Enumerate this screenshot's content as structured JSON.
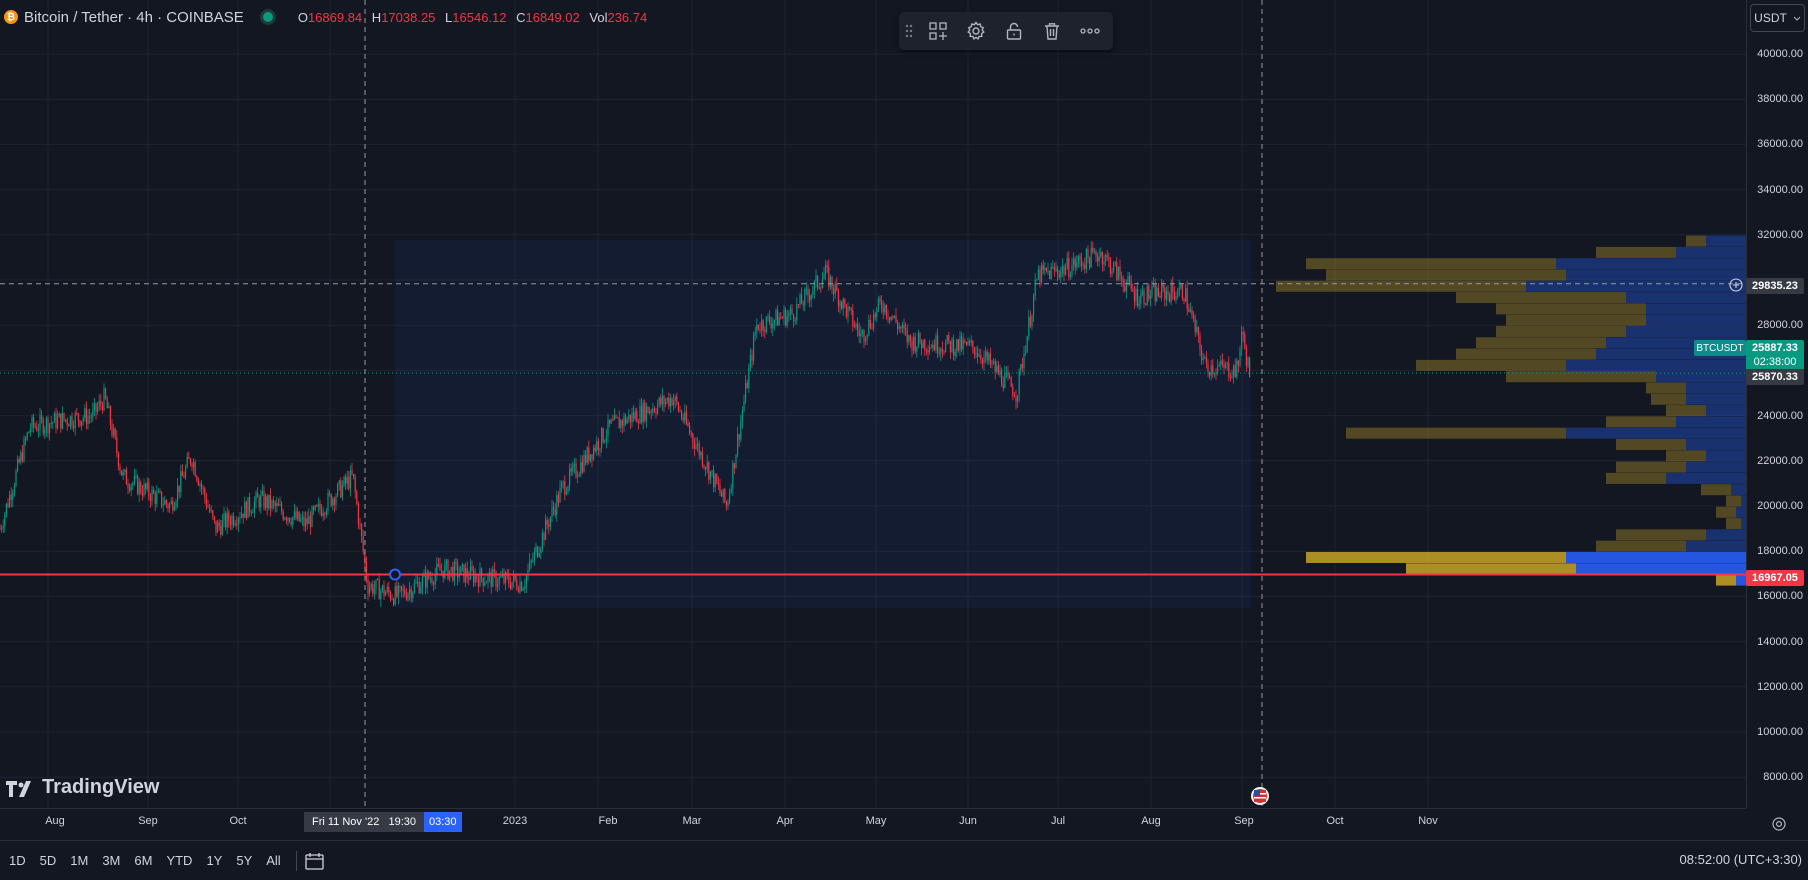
{
  "legend": {
    "symbol": "Bitcoin / Tether · 4h · COINBASE",
    "coin_icon": "bitcoin-icon",
    "ohlc": {
      "o_label": "O",
      "o": "16869.84",
      "h_label": "H",
      "h": "17038.25",
      "l_label": "L",
      "l": "16546.12",
      "c_label": "C",
      "c": "16849.02",
      "vol_label": "Vol",
      "vol": "236.74"
    }
  },
  "toolbar": {
    "icons": [
      "drag-handle-icon",
      "add-object-icon",
      "settings-icon",
      "unlock-icon",
      "trash-icon",
      "more-icon"
    ]
  },
  "currency": {
    "label": "USDT"
  },
  "y_axis": {
    "ticks": [
      "40000.00",
      "38000.00",
      "36000.00",
      "34000.00",
      "32000.00",
      "28000.00",
      "24000.00",
      "22000.00",
      "20000.00",
      "18000.00",
      "16000.00",
      "14000.00",
      "12000.00",
      "10000.00",
      "8000.00"
    ],
    "crosshair_price": "29835.23",
    "last_price": "25887.33",
    "countdown": "02:38:00",
    "prev_price": "25870.33",
    "line_price": "16967.05",
    "symbol_tag": "BTCUSDT"
  },
  "x_axis": {
    "ticks": [
      "Aug",
      "Sep",
      "Oct",
      "2023",
      "Feb",
      "Mar",
      "Apr",
      "May",
      "Jun",
      "Jul",
      "Aug",
      "Sep",
      "Oct",
      "Nov"
    ],
    "crosshair_date": "Fri 11 Nov '22",
    "crosshair_time": "19:30",
    "crosshair_time2": "03:30"
  },
  "watermark": "TradingView",
  "bottom": {
    "ranges": [
      "1D",
      "5D",
      "1M",
      "3M",
      "6M",
      "YTD",
      "1Y",
      "5Y",
      "All"
    ],
    "time": "08:52:00 (UTC+3:30)"
  },
  "colors": {
    "bg": "#131722",
    "up": "#089981",
    "down": "#f23645",
    "line": "#f23645",
    "vp_up": "#2962ff",
    "vp_down": "#c9a227",
    "last": "#089981",
    "accent": "#2962ff"
  },
  "chart_data": {
    "type": "candlestick",
    "interval": "4h",
    "y_range": [
      7000,
      42000
    ],
    "horizontal_line": 16967.05,
    "crosshair_price": 29835.23,
    "path_keypoints": [
      [
        "2022-07-10",
        19000
      ],
      [
        "2022-07-20",
        23500
      ],
      [
        "2022-07-30",
        23800
      ],
      [
        "2022-08-10",
        24000
      ],
      [
        "2022-08-14",
        24800
      ],
      [
        "2022-08-20",
        21300
      ],
      [
        "2022-09-05",
        20000
      ],
      [
        "2022-09-12",
        22200
      ],
      [
        "2022-09-20",
        19000
      ],
      [
        "2022-10-05",
        20300
      ],
      [
        "2022-10-20",
        19200
      ],
      [
        "2022-11-05",
        21300
      ],
      [
        "2022-11-10",
        16500
      ],
      [
        "2022-11-20",
        16000
      ],
      [
        "2022-12-05",
        17200
      ],
      [
        "2022-12-20",
        16800
      ],
      [
        "2023-01-01",
        16600
      ],
      [
        "2023-01-14",
        20800
      ],
      [
        "2023-01-30",
        23500
      ],
      [
        "2023-02-20",
        24800
      ],
      [
        "2023-03-10",
        20000
      ],
      [
        "2023-03-20",
        28000
      ],
      [
        "2023-04-01",
        28500
      ],
      [
        "2023-04-12",
        30300
      ],
      [
        "2023-04-24",
        27500
      ],
      [
        "2023-05-01",
        29000
      ],
      [
        "2023-05-10",
        27300
      ],
      [
        "2023-06-01",
        27000
      ],
      [
        "2023-06-15",
        25000
      ],
      [
        "2023-06-22",
        30200
      ],
      [
        "2023-07-01",
        30500
      ],
      [
        "2023-07-13",
        31200
      ],
      [
        "2023-07-25",
        29300
      ],
      [
        "2023-08-10",
        29500
      ],
      [
        "2023-08-17",
        26200
      ],
      [
        "2023-08-28",
        26000
      ],
      [
        "2023-08-29",
        27800
      ],
      [
        "2023-09-01",
        25800
      ]
    ],
    "volume_profile": [
      {
        "price": 31700,
        "up": 20,
        "down": 40
      },
      {
        "price": 31200,
        "up": 80,
        "down": 70
      },
      {
        "price": 30700,
        "up": 250,
        "down": 190
      },
      {
        "price": 30200,
        "up": 240,
        "down": 180
      },
      {
        "price": 29700,
        "up": 250,
        "down": 220
      },
      {
        "price": 29200,
        "up": 170,
        "down": 120
      },
      {
        "price": 28700,
        "up": 150,
        "down": 100
      },
      {
        "price": 28200,
        "up": 140,
        "down": 100
      },
      {
        "price": 27700,
        "up": 130,
        "down": 120
      },
      {
        "price": 27200,
        "up": 130,
        "down": 140
      },
      {
        "price": 26700,
        "up": 140,
        "down": 150
      },
      {
        "price": 26200,
        "up": 150,
        "down": 180
      },
      {
        "price": 25700,
        "up": 150,
        "down": 90
      },
      {
        "price": 25200,
        "up": 40,
        "down": 60
      },
      {
        "price": 24700,
        "up": 35,
        "down": 60
      },
      {
        "price": 24200,
        "up": 40,
        "down": 40
      },
      {
        "price": 23700,
        "up": 70,
        "down": 70
      },
      {
        "price": 23200,
        "up": 220,
        "down": 180
      },
      {
        "price": 22700,
        "up": 70,
        "down": 60
      },
      {
        "price": 22200,
        "up": 40,
        "down": 40
      },
      {
        "price": 21700,
        "up": 70,
        "down": 60
      },
      {
        "price": 21200,
        "up": 60,
        "down": 80
      },
      {
        "price": 20700,
        "up": 30,
        "down": 15
      },
      {
        "price": 20200,
        "up": 15,
        "down": 5
      },
      {
        "price": 19700,
        "up": 20,
        "down": 10
      },
      {
        "price": 19200,
        "up": 15,
        "down": 5
      },
      {
        "price": 18700,
        "up": 90,
        "down": 40
      },
      {
        "price": 18200,
        "up": 90,
        "down": 60
      },
      {
        "price": 17700,
        "up": 260,
        "down": 180
      },
      {
        "price": 17200,
        "up": 170,
        "down": 170
      },
      {
        "price": 16700,
        "up": 20,
        "down": 10
      }
    ]
  }
}
